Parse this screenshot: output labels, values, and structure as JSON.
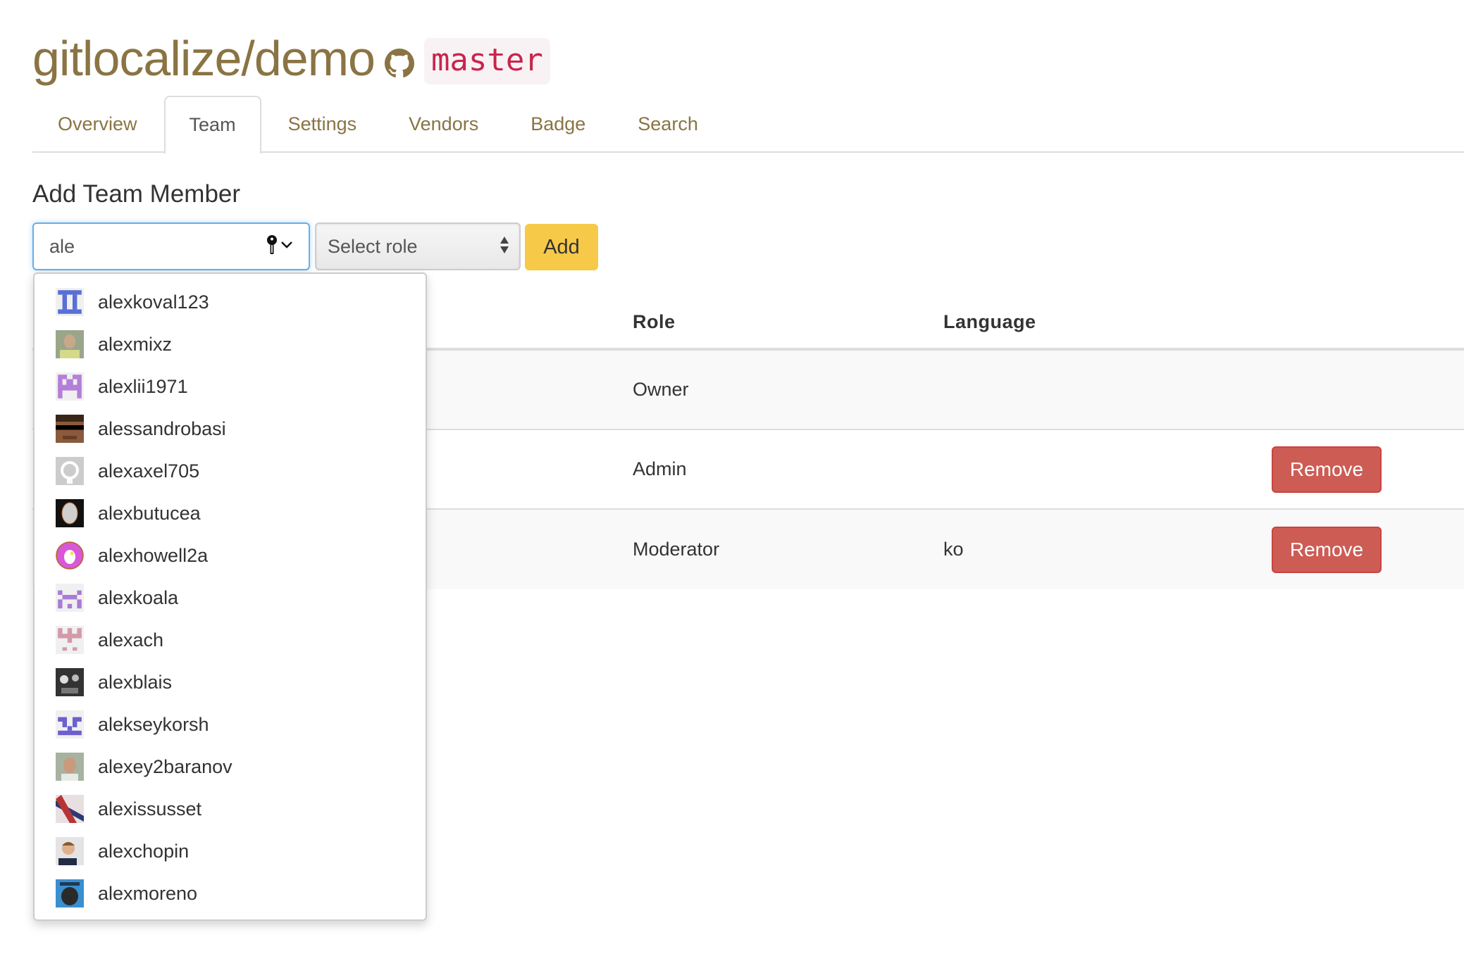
{
  "header": {
    "repo_title": "gitlocalize/demo",
    "branch": "master",
    "accent_color": "#8a7443",
    "branch_color": "#c7254e"
  },
  "tabs": [
    {
      "label": "Overview",
      "active": false
    },
    {
      "label": "Team",
      "active": true
    },
    {
      "label": "Settings",
      "active": false
    },
    {
      "label": "Vendors",
      "active": false
    },
    {
      "label": "Badge",
      "active": false
    },
    {
      "label": "Search",
      "active": false
    }
  ],
  "add_member": {
    "title": "Add Team Member",
    "input_value": "ale",
    "role_placeholder": "Select role",
    "add_label": "Add"
  },
  "suggestions": [
    {
      "username": "alexkoval123",
      "avatar": "identicon-blue"
    },
    {
      "username": "alexmixz",
      "avatar": "photo"
    },
    {
      "username": "alexlii1971",
      "avatar": "identicon-purple"
    },
    {
      "username": "alessandrobasi",
      "avatar": "pixel-face"
    },
    {
      "username": "alexaxel705",
      "avatar": "github-default"
    },
    {
      "username": "alexbutucea",
      "avatar": "fingerprint"
    },
    {
      "username": "alexhowell2a",
      "avatar": "cartoon-dog"
    },
    {
      "username": "alexkoala",
      "avatar": "identicon-violet"
    },
    {
      "username": "alexach",
      "avatar": "identicon-pink"
    },
    {
      "username": "alexblais",
      "avatar": "photo-bw"
    },
    {
      "username": "alekseykorsh",
      "avatar": "identicon-indigo"
    },
    {
      "username": "alexey2baranov",
      "avatar": "photo"
    },
    {
      "username": "alexissusset",
      "avatar": "photo-flag"
    },
    {
      "username": "alexchopin",
      "avatar": "photo"
    },
    {
      "username": "alexmoreno",
      "avatar": "photo"
    }
  ],
  "team_table": {
    "headers": {
      "role": "Role",
      "language": "Language"
    },
    "rows": [
      {
        "role": "Owner",
        "language": "",
        "action": ""
      },
      {
        "role": "Admin",
        "language": "",
        "action": "Remove"
      },
      {
        "role": "Moderator",
        "language": "ko",
        "action": "Remove"
      }
    ]
  },
  "colors": {
    "add_button": "#f7c948",
    "remove_button": "#cd5c55",
    "focus_border": "#66afe9"
  }
}
